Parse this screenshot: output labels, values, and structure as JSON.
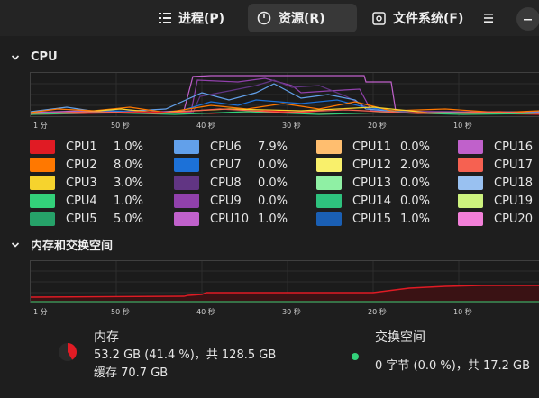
{
  "tabs": [
    {
      "label": "进程(P)",
      "icon": "list-icon"
    },
    {
      "label": "资源(R)",
      "icon": "gauge-icon"
    },
    {
      "label": "文件系统(F)",
      "icon": "disk-icon"
    }
  ],
  "cpu_section": {
    "title": "CPU"
  },
  "mem_section": {
    "title": "内存和交换空间"
  },
  "time_axis": [
    "1 分",
    "50 秒",
    "40 秒",
    "30 秒",
    "20 秒",
    "10 秒"
  ],
  "cpus": [
    {
      "name": "CPU1",
      "value": "1.0%",
      "color": "#e01b24"
    },
    {
      "name": "CPU2",
      "value": "8.0%",
      "color": "#ff7800"
    },
    {
      "name": "CPU3",
      "value": "3.0%",
      "color": "#f6d32d"
    },
    {
      "name": "CPU4",
      "value": "1.0%",
      "color": "#33d17a"
    },
    {
      "name": "CPU5",
      "value": "5.0%",
      "color": "#26a269"
    },
    {
      "name": "CPU6",
      "value": "7.9%",
      "color": "#62a0ea"
    },
    {
      "name": "CPU7",
      "value": "0.0%",
      "color": "#1c71d8"
    },
    {
      "name": "CPU8",
      "value": "0.0%",
      "color": "#613583"
    },
    {
      "name": "CPU9",
      "value": "0.0%",
      "color": "#9141ac"
    },
    {
      "name": "CPU10",
      "value": "1.0%",
      "color": "#c061cb"
    },
    {
      "name": "CPU11",
      "value": "0.0%",
      "color": "#ffbe6f"
    },
    {
      "name": "CPU12",
      "value": "2.0%",
      "color": "#f9f06b"
    },
    {
      "name": "CPU13",
      "value": "0.0%",
      "color": "#8ff0a4"
    },
    {
      "name": "CPU14",
      "value": "0.0%",
      "color": "#2ec27e"
    },
    {
      "name": "CPU15",
      "value": "1.0%",
      "color": "#1a5fb4"
    },
    {
      "name": "CPU16",
      "value": "",
      "color": "#c061cb"
    },
    {
      "name": "CPU17",
      "value": "",
      "color": "#f66151"
    },
    {
      "name": "CPU18",
      "value": "",
      "color": "#99c1f1"
    },
    {
      "name": "CPU19",
      "value": "",
      "color": "#cdf27e"
    },
    {
      "name": "CPU20",
      "value": "",
      "color": "#f27fd8"
    }
  ],
  "memory": {
    "title": "内存",
    "usage": "53.2 GB (41.4 %)，共 128.5 GB",
    "cache": "缓存 70.7 GB",
    "fraction": 0.414,
    "color": "#e01b24"
  },
  "swap": {
    "title": "交换空间",
    "usage": "0 字节 (0.0 %)，共 17.2 GB",
    "fraction": 0.0,
    "color": "#33d17a"
  }
}
